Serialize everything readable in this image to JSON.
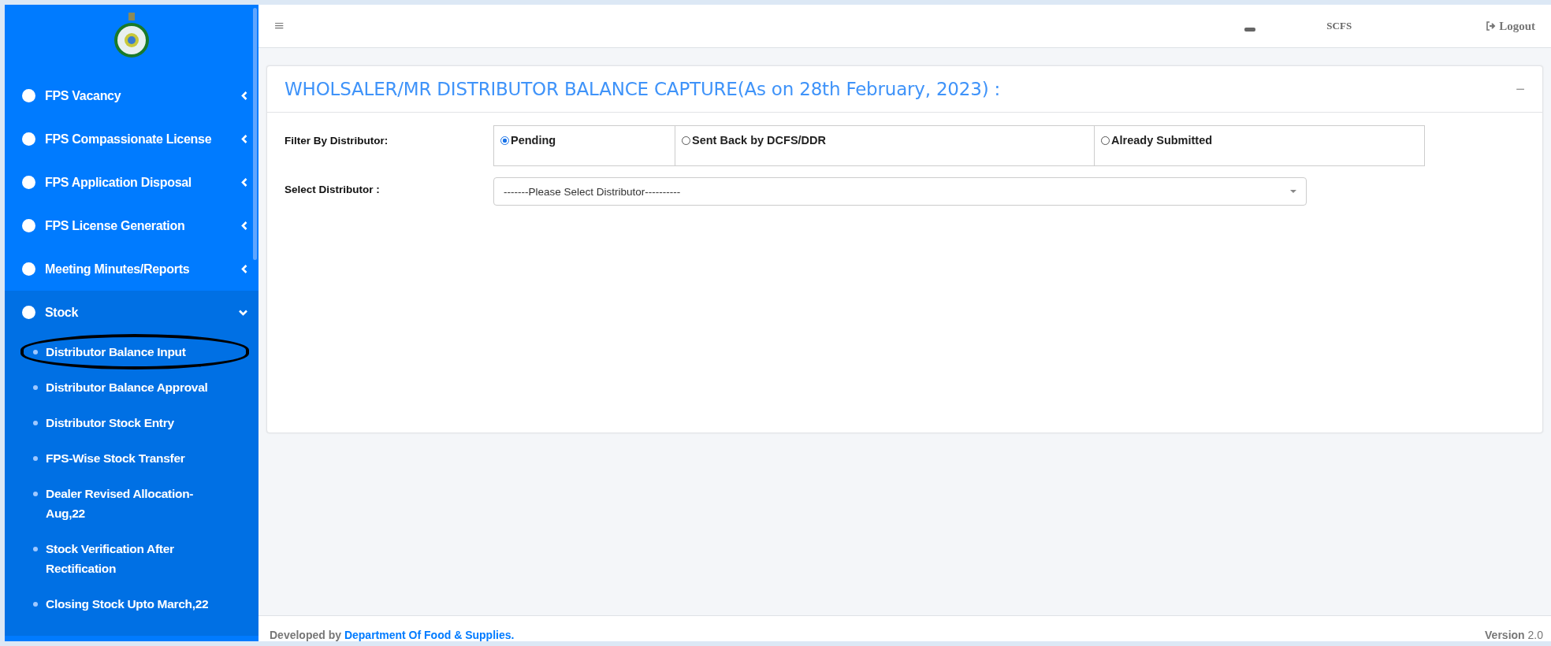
{
  "sidebar": {
    "items": [
      {
        "label": "FPS Vacancy",
        "expanded": false
      },
      {
        "label": "FPS Compassionate License",
        "expanded": false
      },
      {
        "label": "FPS Application Disposal",
        "expanded": false
      },
      {
        "label": "FPS License Generation",
        "expanded": false
      },
      {
        "label": "Meeting Minutes/Reports",
        "expanded": false
      },
      {
        "label": "Stock",
        "expanded": true,
        "children": [
          {
            "label": "Distributor Balance Input",
            "annotated": true
          },
          {
            "label": "Distributor Balance Approval",
            "annotated": false
          },
          {
            "label": "Distributor Stock Entry",
            "annotated": false
          },
          {
            "label": "FPS-Wise Stock Transfer",
            "annotated": false
          },
          {
            "label": "Dealer Revised Allocation-Aug,22",
            "annotated": false
          },
          {
            "label": "Stock Verification After Rectification",
            "annotated": false
          },
          {
            "label": "Closing Stock Upto March,22",
            "annotated": false
          }
        ]
      }
    ]
  },
  "top_bar": {
    "menu_icon": "≡",
    "user_role": "SCFS",
    "logout": "Logout"
  },
  "card": {
    "title": "WHOLSALER/MR DISTRIBUTOR BALANCE CAPTURE(As on 28th February, 2023) :",
    "collapse": "−",
    "filter": {
      "label": "Filter By Distributor:",
      "options": [
        {
          "label": "Pending",
          "selected": true
        },
        {
          "label": "Sent Back by DCFS/DDR",
          "selected": false
        },
        {
          "label": "Already Submitted",
          "selected": false
        }
      ]
    },
    "distributor": {
      "label": "Select Distributor :",
      "value": "-------Please Select Distributor----------"
    }
  },
  "footer": {
    "prefix": "Developed by",
    "link": "Department Of Food & Supplies.",
    "version_label": "Version",
    "version": "2.0"
  }
}
